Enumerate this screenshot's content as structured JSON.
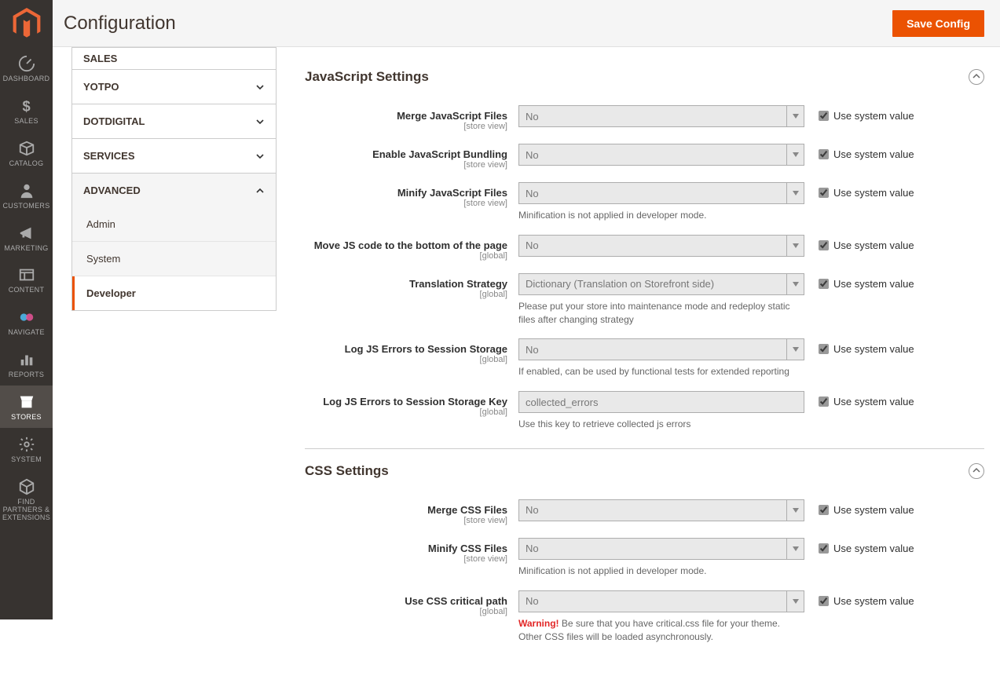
{
  "header": {
    "title": "Configuration",
    "save_label": "Save Config"
  },
  "nav": {
    "items": [
      {
        "label": "DASHBOARD"
      },
      {
        "label": "SALES"
      },
      {
        "label": "CATALOG"
      },
      {
        "label": "CUSTOMERS"
      },
      {
        "label": "MARKETING"
      },
      {
        "label": "CONTENT"
      },
      {
        "label": "NAVIGATE"
      },
      {
        "label": "REPORTS"
      },
      {
        "label": "STORES"
      },
      {
        "label": "SYSTEM"
      },
      {
        "label": "FIND PARTNERS & EXTENSIONS"
      }
    ]
  },
  "sidebar": {
    "tabs": [
      {
        "label": "SALES"
      },
      {
        "label": "YOTPO"
      },
      {
        "label": "DOTDIGITAL"
      },
      {
        "label": "SERVICES"
      },
      {
        "label": "ADVANCED",
        "items": [
          {
            "label": "Admin"
          },
          {
            "label": "System"
          },
          {
            "label": "Developer"
          }
        ]
      }
    ]
  },
  "use_system_label": "Use system value",
  "sections": {
    "js": {
      "title": "JavaScript Settings",
      "fields": [
        {
          "label": "Merge JavaScript Files",
          "scope": "[store view]",
          "value": "No"
        },
        {
          "label": "Enable JavaScript Bundling",
          "scope": "[store view]",
          "value": "No"
        },
        {
          "label": "Minify JavaScript Files",
          "scope": "[store view]",
          "value": "No",
          "note": "Minification is not applied in developer mode."
        },
        {
          "label": "Move JS code to the bottom of the page",
          "scope": "[global]",
          "value": "No"
        },
        {
          "label": "Translation Strategy",
          "scope": "[global]",
          "value": "Dictionary (Translation on Storefront side)",
          "note": "Please put your store into maintenance mode and redeploy static files after changing strategy"
        },
        {
          "label": "Log JS Errors to Session Storage",
          "scope": "[global]",
          "value": "No",
          "note": "If enabled, can be used by functional tests for extended reporting"
        },
        {
          "label": "Log JS Errors to Session Storage Key",
          "scope": "[global]",
          "value": "collected_errors",
          "note": "Use this key to retrieve collected js errors",
          "type": "text"
        }
      ]
    },
    "css": {
      "title": "CSS Settings",
      "fields": [
        {
          "label": "Merge CSS Files",
          "scope": "[store view]",
          "value": "No"
        },
        {
          "label": "Minify CSS Files",
          "scope": "[store view]",
          "value": "No",
          "note": "Minification is not applied in developer mode."
        },
        {
          "label": "Use CSS critical path",
          "scope": "[global]",
          "value": "No",
          "warn": "Warning!",
          "note": " Be sure that you have critical.css file for your theme. Other CSS files will be loaded asynchronously."
        }
      ]
    }
  }
}
